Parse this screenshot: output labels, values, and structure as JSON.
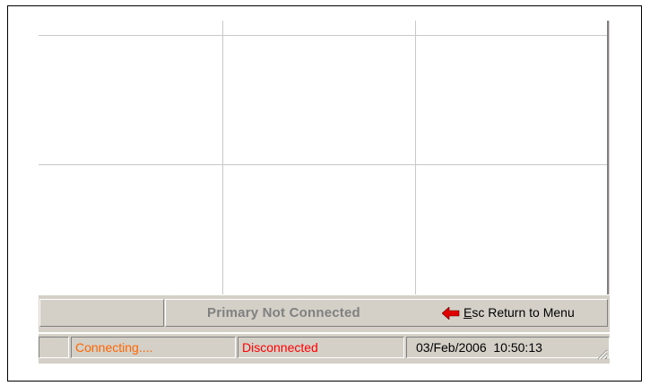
{
  "toolbar": {
    "primary_status": "Primary Not Connected",
    "esc_label_key": "E",
    "esc_label_rest": "sc Return to Menu",
    "arrow_color": "#e00000"
  },
  "statusbar": {
    "connection_state": "Connecting....",
    "connection_state_color": "#ff6600",
    "link_state": "Disconnected",
    "link_state_color": "#ff0000",
    "datetime": "03/Feb/2006  10:50:13"
  }
}
